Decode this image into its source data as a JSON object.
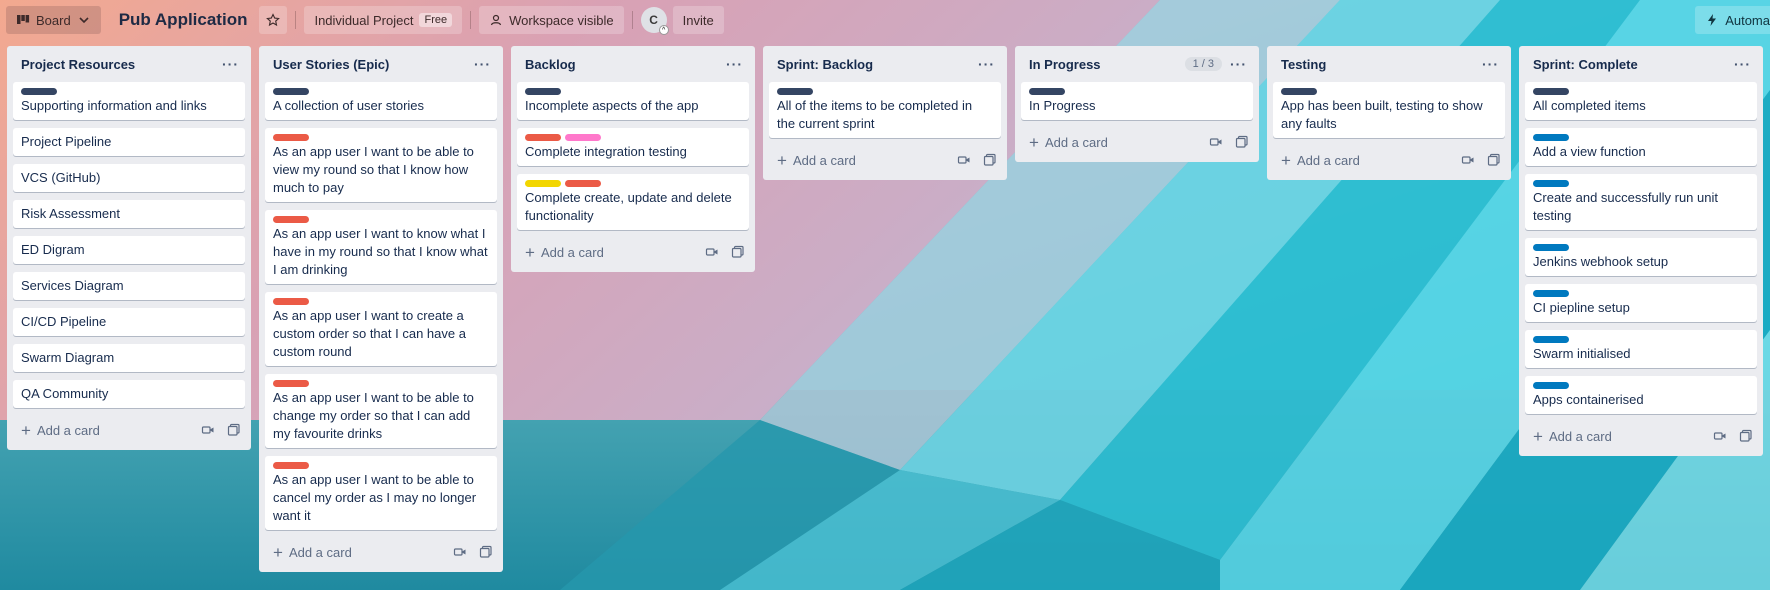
{
  "topbar": {
    "board_view_label": "Board",
    "board_title": "Pub Application",
    "project_label": "Individual Project",
    "plan_badge": "Free",
    "visibility_label": "Workspace visible",
    "avatar_initial": "C",
    "invite_label": "Invite",
    "automation_label": "Automa"
  },
  "colors": {
    "label_dark": "#344563",
    "label_red": "#eb5a46",
    "label_pink": "#ff78cb",
    "label_yellow": "#f2d600",
    "label_blue": "#0079bf"
  },
  "common": {
    "add_card_label": "Add a card"
  },
  "lists": [
    {
      "title": "Project Resources",
      "cards": [
        {
          "text": "Supporting information and links",
          "labels": [
            "dark"
          ]
        },
        {
          "text": "Project Pipeline",
          "labels": []
        },
        {
          "text": "VCS (GitHub)",
          "labels": []
        },
        {
          "text": "Risk Assessment",
          "labels": []
        },
        {
          "text": "ED Digram",
          "labels": []
        },
        {
          "text": "Services Diagram",
          "labels": []
        },
        {
          "text": "CI/CD Pipeline",
          "labels": []
        },
        {
          "text": "Swarm Diagram",
          "labels": []
        },
        {
          "text": "QA Community",
          "labels": []
        }
      ]
    },
    {
      "title": "User Stories (Epic)",
      "cards": [
        {
          "text": "A collection of user stories",
          "labels": [
            "dark"
          ]
        },
        {
          "text": "As an app user I want to be able to view my round so that I know how much to pay",
          "labels": [
            "red"
          ]
        },
        {
          "text": "As an app user I want to know what I have in my round so that I know what I am drinking",
          "labels": [
            "red"
          ]
        },
        {
          "text": "As an app user I want to create a custom order so that I can have a custom round",
          "labels": [
            "red"
          ]
        },
        {
          "text": "As an app user I want to be able to change my order so that I can add my favourite drinks",
          "labels": [
            "red"
          ]
        },
        {
          "text": "As an app user I want to be able to cancel my order as I may no longer want it",
          "labels": [
            "red"
          ]
        }
      ]
    },
    {
      "title": "Backlog",
      "cards": [
        {
          "text": "Incomplete aspects of the app",
          "labels": [
            "dark"
          ]
        },
        {
          "text": "Complete integration testing",
          "labels": [
            "red",
            "pink"
          ]
        },
        {
          "text": "Complete create, update and delete functionality",
          "labels": [
            "yellow",
            "red"
          ]
        }
      ]
    },
    {
      "title": "Sprint: Backlog",
      "cards": [
        {
          "text": "All of the items to be completed in the current sprint",
          "labels": [
            "dark"
          ]
        }
      ]
    },
    {
      "title": "In Progress",
      "count": "1 / 3",
      "cards": [
        {
          "text": "In Progress",
          "labels": [
            "dark"
          ]
        }
      ]
    },
    {
      "title": "Testing",
      "cards": [
        {
          "text": "App has been built, testing to show any faults",
          "labels": [
            "dark"
          ]
        }
      ]
    },
    {
      "title": "Sprint: Complete",
      "cards": [
        {
          "text": "All completed items",
          "labels": [
            "dark"
          ]
        },
        {
          "text": "Add a view function",
          "labels": [
            "blue"
          ]
        },
        {
          "text": "Create and successfully run unit testing",
          "labels": [
            "blue"
          ]
        },
        {
          "text": "Jenkins webhook setup",
          "labels": [
            "blue"
          ]
        },
        {
          "text": "CI piepline setup",
          "labels": [
            "blue"
          ]
        },
        {
          "text": "Swarm initialised",
          "labels": [
            "blue"
          ]
        },
        {
          "text": "Apps containerised",
          "labels": [
            "blue"
          ]
        }
      ]
    }
  ]
}
